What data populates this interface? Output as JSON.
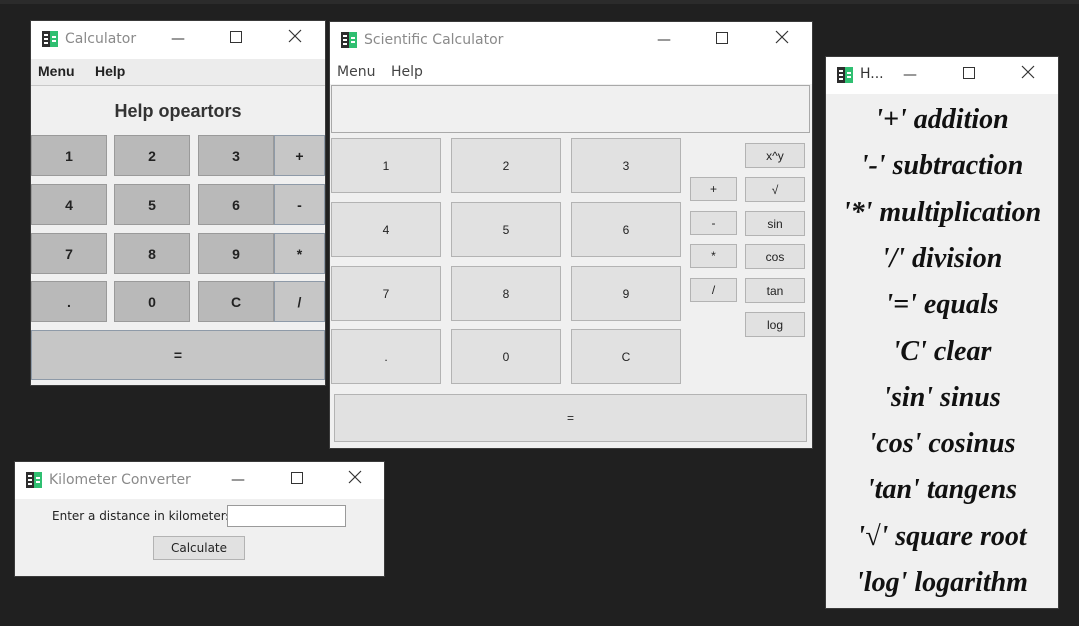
{
  "calculator": {
    "title": "Calculator",
    "menu": [
      "Menu",
      "Help"
    ],
    "header": "Help opeartors",
    "keys": [
      {
        "label": "1",
        "type": "digit"
      },
      {
        "label": "2",
        "type": "digit"
      },
      {
        "label": "3",
        "type": "digit"
      },
      {
        "label": "+",
        "type": "op"
      },
      {
        "label": "4",
        "type": "digit"
      },
      {
        "label": "5",
        "type": "digit"
      },
      {
        "label": "6",
        "type": "digit"
      },
      {
        "label": "-",
        "type": "op"
      },
      {
        "label": "7",
        "type": "digit"
      },
      {
        "label": "8",
        "type": "digit"
      },
      {
        "label": "9",
        "type": "digit"
      },
      {
        "label": "*",
        "type": "op"
      },
      {
        "label": ".",
        "type": "digit"
      },
      {
        "label": "0",
        "type": "digit"
      },
      {
        "label": "C",
        "type": "digit"
      },
      {
        "label": "/",
        "type": "op"
      }
    ],
    "equals": "="
  },
  "scientific": {
    "title": "Scientific Calculator",
    "menu": [
      "Menu",
      "Help"
    ],
    "display": "",
    "digits": [
      "1",
      "2",
      "3",
      "4",
      "5",
      "6",
      "7",
      "8",
      "9",
      ".",
      "0",
      "C"
    ],
    "ops": [
      "+",
      "-",
      "*",
      "/"
    ],
    "functions": [
      "x^y",
      "√",
      "sin",
      "cos",
      "tan",
      "log"
    ],
    "equals": "="
  },
  "help": {
    "title": "H...",
    "lines": [
      "'+' addition",
      "'-' subtraction",
      "'*' multiplication",
      "'/'  division",
      "'=' equals",
      "'C' clear",
      "'sin' sinus",
      "'cos' cosinus",
      "'tan' tangens",
      "'√' square root",
      "'log' logarithm"
    ]
  },
  "converter": {
    "title": "Kilometer Converter",
    "label": "Enter a distance in kilometers",
    "input_value": "",
    "button": "Calculate"
  },
  "colors": {
    "desktop": "#202020",
    "window_bg": "#f0f0f0",
    "icon_green": "#2fbf71",
    "icon_dark": "#2d2d2d"
  }
}
